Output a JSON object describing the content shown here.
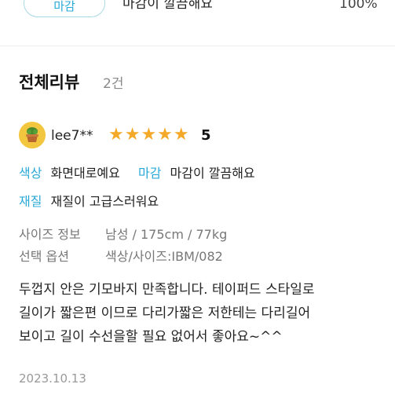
{
  "top_row": {
    "tag": "마감",
    "text": "마감이 깔끔해요",
    "percent": "100%"
  },
  "section": {
    "title": "전체리뷰",
    "count": "2건"
  },
  "review": {
    "user": {
      "name": "lee7**",
      "avatar_icon": "plant-pot-icon"
    },
    "stars": "★★★★★",
    "score": "5",
    "attributes": [
      {
        "key": "색상",
        "value": "화면대로예요"
      },
      {
        "key": "마감",
        "value": "마감이 깔끔해요"
      },
      {
        "key": "재질",
        "value": "재질이 고급스러워요"
      }
    ],
    "size_info": {
      "label": "사이즈 정보",
      "value": "남성 / 175cm / 77kg"
    },
    "option_info": {
      "label": "선택 옵션",
      "value": "색상/사이즈:IBM/082"
    },
    "body_lines": [
      "두껍지 안은 기모바지 만족합니다. 테이퍼드 스타일로",
      "길이가 짧은편 이므로 다리가짧은 저한테는 다리길어",
      "보이고 길이 수선을할 필요 없어서 좋아요~^^"
    ],
    "date": "2023.10.13"
  },
  "colors": {
    "accent": "#2aa9d8",
    "star": "#f4a928",
    "muted": "#777777"
  }
}
